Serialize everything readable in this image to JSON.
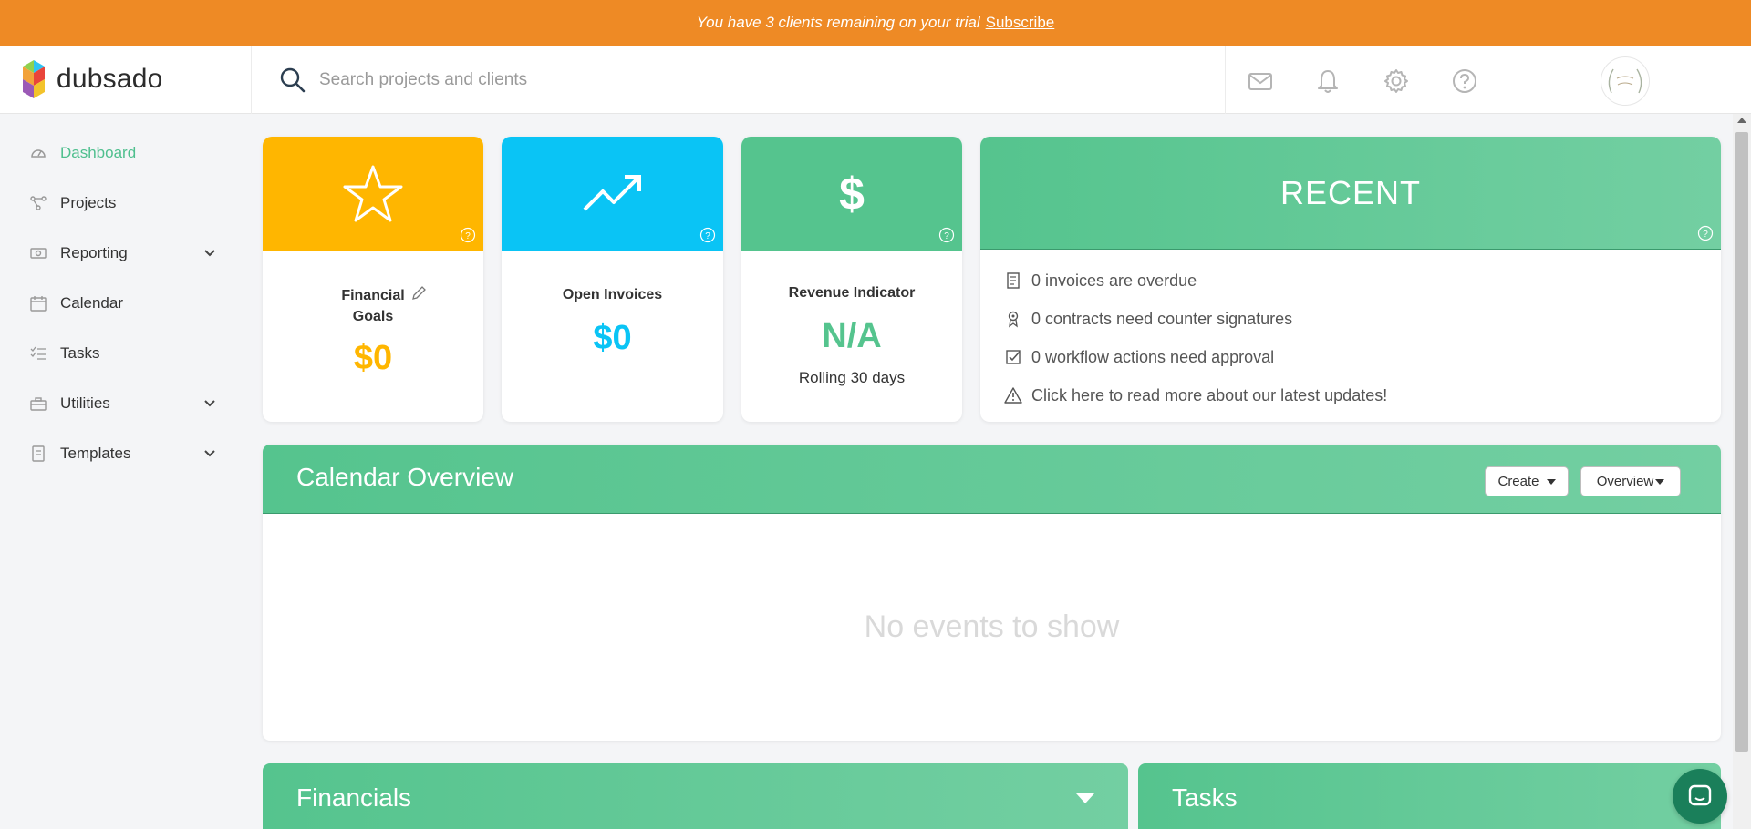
{
  "banner": {
    "text": "You have 3 clients remaining on your trial",
    "link": "Subscribe"
  },
  "header": {
    "logo_text": "dubsado",
    "search_placeholder": "Search projects and clients",
    "icons": [
      "mail-icon",
      "bell-icon",
      "gear-icon",
      "help-icon"
    ]
  },
  "sidebar": {
    "items": [
      {
        "label": "Dashboard",
        "icon": "dashboard-icon",
        "active": true
      },
      {
        "label": "Projects",
        "icon": "projects-icon"
      },
      {
        "label": "Reporting",
        "icon": "reporting-icon",
        "expandable": true
      },
      {
        "label": "Calendar",
        "icon": "calendar-icon"
      },
      {
        "label": "Tasks",
        "icon": "tasks-icon"
      },
      {
        "label": "Utilities",
        "icon": "utilities-icon",
        "expandable": true
      },
      {
        "label": "Templates",
        "icon": "templates-icon",
        "expandable": true
      }
    ]
  },
  "cards": {
    "financial_goals": {
      "title_line1": "Financial",
      "title_line2": "Goals",
      "value": "$0",
      "color": "#ffb600"
    },
    "open_invoices": {
      "title": "Open Invoices",
      "value": "$0",
      "color": "#0ac4f5"
    },
    "revenue_indicator": {
      "title": "Revenue Indicator",
      "value": "N/A",
      "subtitle": "Rolling 30 days",
      "color": "#55c48e"
    }
  },
  "recent": {
    "title": "RECENT",
    "items": [
      {
        "text": "0 invoices are overdue",
        "icon": "invoice-icon"
      },
      {
        "text": "0 contracts need counter signatures",
        "icon": "ribbon-icon"
      },
      {
        "text": "0 workflow actions need approval",
        "icon": "checkbox-icon"
      },
      {
        "text": "Click here to read more about our latest updates!",
        "icon": "warning-icon"
      }
    ]
  },
  "calendar": {
    "title": "Calendar Overview",
    "create_label": "Create",
    "overview_label": "Overview",
    "empty_text": "No events to show"
  },
  "panels": {
    "financials": "Financials",
    "tasks": "Tasks"
  },
  "colors": {
    "accent_green": "#55c48e",
    "banner_orange": "#ee8a25",
    "yellow": "#ffb600",
    "cyan": "#0ac4f5"
  }
}
